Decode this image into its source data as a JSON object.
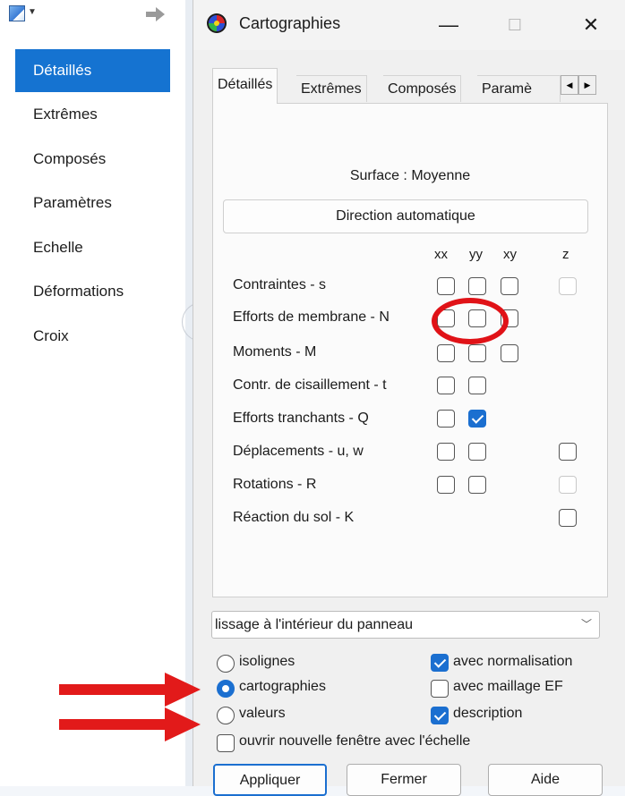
{
  "sidebar": {
    "items": [
      {
        "label": "Détaillés"
      },
      {
        "label": "Extrêmes"
      },
      {
        "label": "Composés"
      },
      {
        "label": "Paramètres"
      },
      {
        "label": "Echelle"
      },
      {
        "label": "Déformations"
      },
      {
        "label": "Croix"
      }
    ]
  },
  "window": {
    "title": "Cartographies",
    "controls": {
      "minimize": "—",
      "maximize": "☐",
      "close": "✕"
    }
  },
  "tabs": [
    {
      "label": "Détaillés"
    },
    {
      "label": "Extrêmes"
    },
    {
      "label": "Composés"
    },
    {
      "label": "Paramè"
    }
  ],
  "panel": {
    "surface_label": "Surface : Moyenne",
    "direction_button": "Direction automatique",
    "columns": [
      "xx",
      "yy",
      "xy",
      "z"
    ],
    "rows": [
      {
        "label": "Contraintes - s"
      },
      {
        "label": "Efforts de membrane - N"
      },
      {
        "label": "Moments - M"
      },
      {
        "label": "Contr. de cisaillement - t"
      },
      {
        "label": "Efforts tranchants - Q"
      },
      {
        "label": "Déplacements - u, w"
      },
      {
        "label": "Rotations - R"
      },
      {
        "label": "Réaction du sol - K"
      }
    ]
  },
  "smoothing": {
    "selected": "lissage à l'intérieur du panneau"
  },
  "display": {
    "isolignes": "isolignes",
    "cartographies": "cartographies",
    "valeurs": "valeurs",
    "selected": "cartographies",
    "normalisation": "avec normalisation",
    "maillage": "avec maillage EF",
    "description": "description",
    "open_scale": "ouvrir nouvelle fenêtre avec l'échelle"
  },
  "buttons": {
    "apply": "Appliquer",
    "close": "Fermer",
    "help": "Aide"
  },
  "colors": {
    "accent": "#1b6fd0",
    "highlight": "#e01217",
    "selected_item": "#1573d1"
  }
}
